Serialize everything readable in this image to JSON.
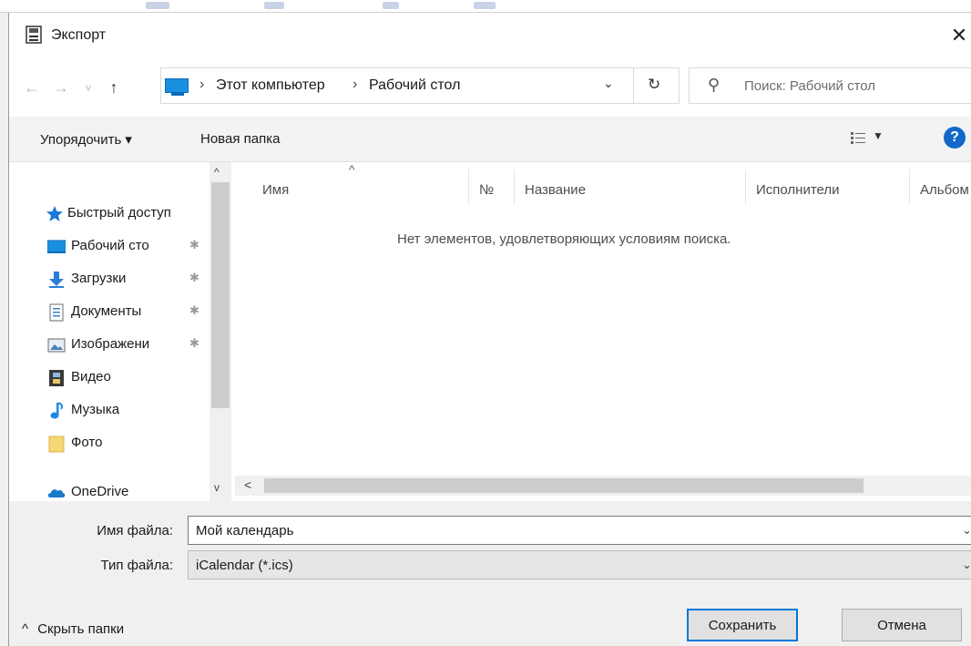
{
  "window": {
    "title": "Экспорт",
    "close_glyph": "✕"
  },
  "nav": {
    "back_glyph": "←",
    "forward_glyph": "→",
    "recent_glyph": "˅",
    "up_glyph": "↑",
    "breadcrumb": [
      "Этот компьютер",
      "Рабочий стол"
    ],
    "breadcrumb_sep": "›",
    "dropdown_glyph": "⌄",
    "refresh_glyph": "↻",
    "search_placeholder": "Поиск: Рабочий стол",
    "search_glyph": "⚲"
  },
  "toolbar": {
    "organize_label": "Упорядочить ▾",
    "new_folder_label": "Новая папка",
    "help_label": "?"
  },
  "sidebar": {
    "quick_access": "Быстрый доступ",
    "items": [
      {
        "label": "Рабочий сто",
        "icon": "desktop-icon",
        "pinned": true
      },
      {
        "label": "Загрузки",
        "icon": "downloads-icon",
        "pinned": true
      },
      {
        "label": "Документы",
        "icon": "documents-icon",
        "pinned": true
      },
      {
        "label": "Изображени",
        "icon": "pictures-icon",
        "pinned": true
      },
      {
        "label": "Видео",
        "icon": "video-icon",
        "pinned": false
      },
      {
        "label": "Музыка",
        "icon": "music-icon",
        "pinned": false
      },
      {
        "label": "Фото",
        "icon": "folder-icon",
        "pinned": false
      }
    ],
    "onedrive": "OneDrive",
    "pin_glyph": "📌"
  },
  "list": {
    "columns": [
      "Имя",
      "№",
      "Название",
      "Исполнители",
      "Альбом"
    ],
    "empty_message": "Нет элементов, удовлетворяющих условиям поиска."
  },
  "form": {
    "filename_label": "Имя файла:",
    "filename_value": "Мой календарь",
    "filetype_label": "Тип файла:",
    "filetype_value": "iCalendar (*.ics)"
  },
  "footer": {
    "hide_folders_label": "Скрыть папки",
    "hide_folders_glyph": "^",
    "save_label": "Сохранить",
    "cancel_label": "Отмена"
  },
  "colors": {
    "accent": "#0078d7",
    "desktop_blue": "#1a8fe0",
    "onedrive_blue": "#1979ca",
    "help_blue": "#1368c9"
  }
}
